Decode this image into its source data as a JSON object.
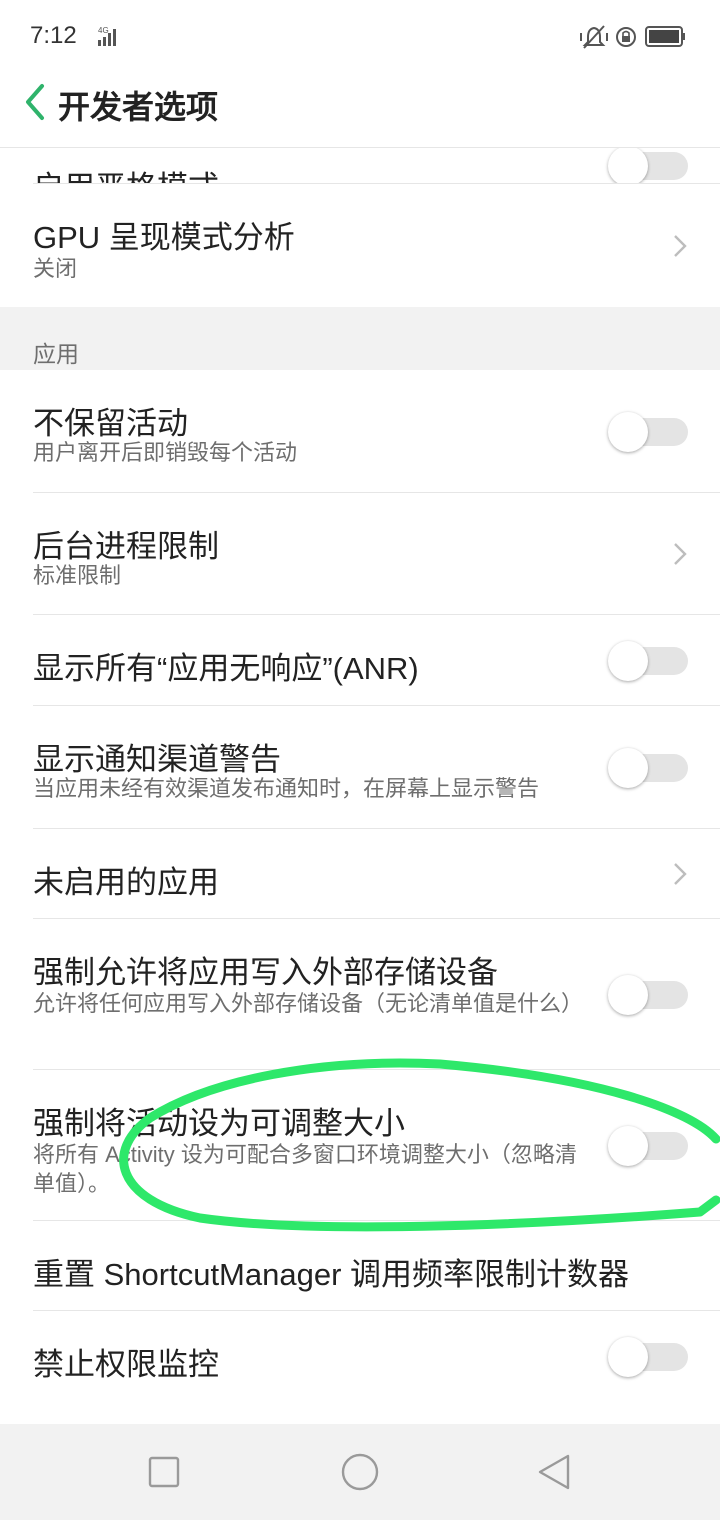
{
  "status_bar": {
    "time": "7:12",
    "network": "4G"
  },
  "header": {
    "title": "开发者选项",
    "back_icon": "chevron-left-icon"
  },
  "partial_top_item": {
    "title": "启用严格模式"
  },
  "gpu_item": {
    "title": "GPU 呈现模式分析",
    "subtitle": "关闭"
  },
  "section": {
    "title": "应用"
  },
  "items": [
    {
      "title": "不保留活动",
      "subtitle": "用户离开后即销毁每个活动",
      "control": "toggle",
      "on": false
    },
    {
      "title": "后台进程限制",
      "subtitle": "标准限制",
      "control": "chevron"
    },
    {
      "title": "显示所有“应用无响应”(ANR)",
      "subtitle": "",
      "control": "toggle",
      "on": false
    },
    {
      "title": "显示通知渠道警告",
      "subtitle": "当应用未经有效渠道发布通知时，在屏幕上显示警告",
      "control": "toggle",
      "on": false
    },
    {
      "title": "未启用的应用",
      "subtitle": "",
      "control": "chevron"
    },
    {
      "title": "强制允许将应用写入外部存储设备",
      "subtitle": "允许将任何应用写入外部存储设备（无论清单值是什么）",
      "control": "toggle",
      "on": false
    },
    {
      "title": "强制将活动设为可调整大小",
      "subtitle": "将所有 Activity 设为可配合多窗口环境调整大小（忽略清单值）。",
      "control": "toggle",
      "on": false
    },
    {
      "title": "重置 ShortcutManager 调用频率限制计数器",
      "subtitle": "",
      "control": "none"
    },
    {
      "title": "禁止权限监控",
      "subtitle": "",
      "control": "toggle",
      "on": false
    }
  ],
  "colors": {
    "accent": "#2fb36b",
    "annotation": "#2ee86a",
    "section_bg": "#f2f2f2",
    "toggle_track": "#e4e4e4"
  },
  "navbar": {
    "icons": [
      "square-recents-icon",
      "circle-home-icon",
      "triangle-back-icon"
    ]
  }
}
